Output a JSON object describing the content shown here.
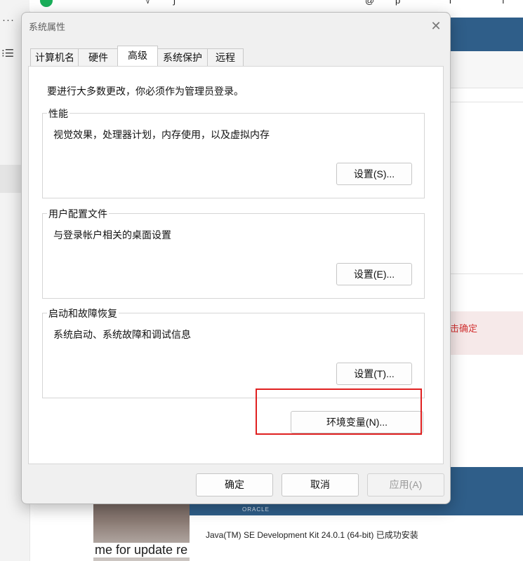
{
  "dialog": {
    "title": "系统属性",
    "close_icon": "close-icon",
    "tabs": [
      {
        "label": "计算机名"
      },
      {
        "label": "硬件"
      },
      {
        "label": "高级",
        "active": true
      },
      {
        "label": "系统保护"
      },
      {
        "label": "远程"
      }
    ],
    "intro": "要进行大多数更改，你必须作为管理员登录。",
    "groups": [
      {
        "label": "性能",
        "description": "视觉效果，处理器计划，内存使用，以及虚拟内存",
        "button": "设置(S)..."
      },
      {
        "label": "用户配置文件",
        "description": "与登录帐户相关的桌面设置",
        "button": "设置(E)..."
      },
      {
        "label": "启动和故障恢复",
        "description": "系统启动、系统故障和调试信息",
        "button": "设置(T)..."
      }
    ],
    "env_button": "环境变量(N)...",
    "highlight_color": "#e02020",
    "footer": {
      "ok": "确定",
      "cancel": "取消",
      "apply": "应用(A)"
    }
  },
  "background": {
    "left_icons": [
      "more-dots-icon",
      "list-icon"
    ],
    "top_fragments": [
      "√",
      "ʃ",
      "@",
      "p",
      "l",
      "ı"
    ],
    "right_hint": "击确定",
    "oracle_logo": "ORACLE",
    "bottom_left_text": "me for update re",
    "installer_message": "Java(TM) SE Development Kit 24.0.1 (64-bit) 已成功安装",
    "accent_blue": "#2f5e89"
  }
}
